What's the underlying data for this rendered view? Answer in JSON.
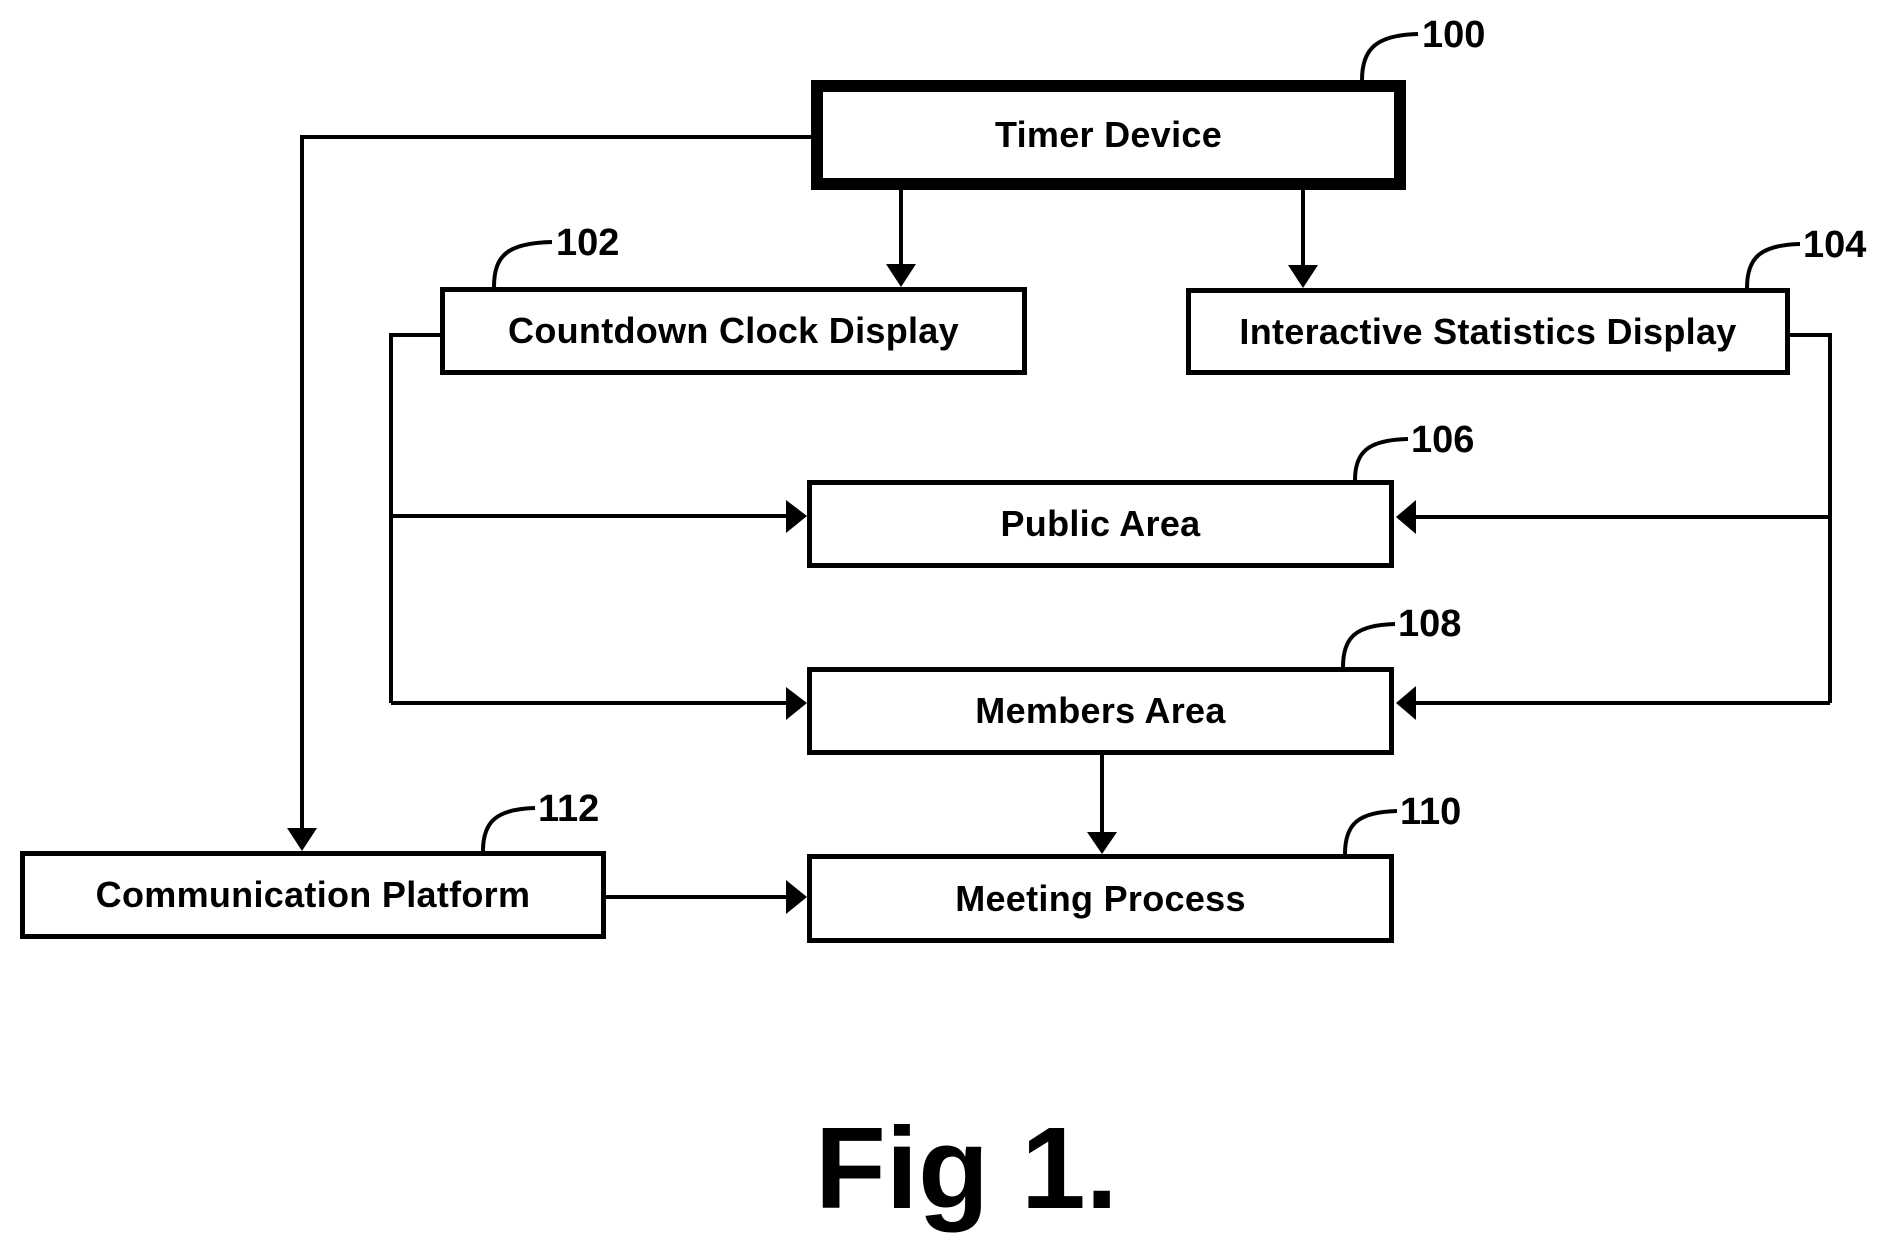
{
  "diagram": {
    "nodes": [
      {
        "id": "timer",
        "label": "Timer Device",
        "ref": "100"
      },
      {
        "id": "countdown",
        "label": "Countdown Clock Display",
        "ref": "102"
      },
      {
        "id": "stats",
        "label": "Interactive Statistics Display",
        "ref": "104"
      },
      {
        "id": "public",
        "label": "Public Area",
        "ref": "106"
      },
      {
        "id": "members",
        "label": "Members Area",
        "ref": "108"
      },
      {
        "id": "meeting",
        "label": "Meeting Process",
        "ref": "110"
      },
      {
        "id": "comm",
        "label": "Communication Platform",
        "ref": "112"
      }
    ],
    "edges": [
      {
        "from": "timer",
        "to": "countdown"
      },
      {
        "from": "timer",
        "to": "stats"
      },
      {
        "from": "timer",
        "to": "comm"
      },
      {
        "from": "countdown",
        "to": "public"
      },
      {
        "from": "countdown",
        "to": "members"
      },
      {
        "from": "stats",
        "to": "public"
      },
      {
        "from": "stats",
        "to": "members"
      },
      {
        "from": "members",
        "to": "meeting"
      },
      {
        "from": "comm",
        "to": "meeting"
      }
    ],
    "caption": "Fig 1."
  }
}
